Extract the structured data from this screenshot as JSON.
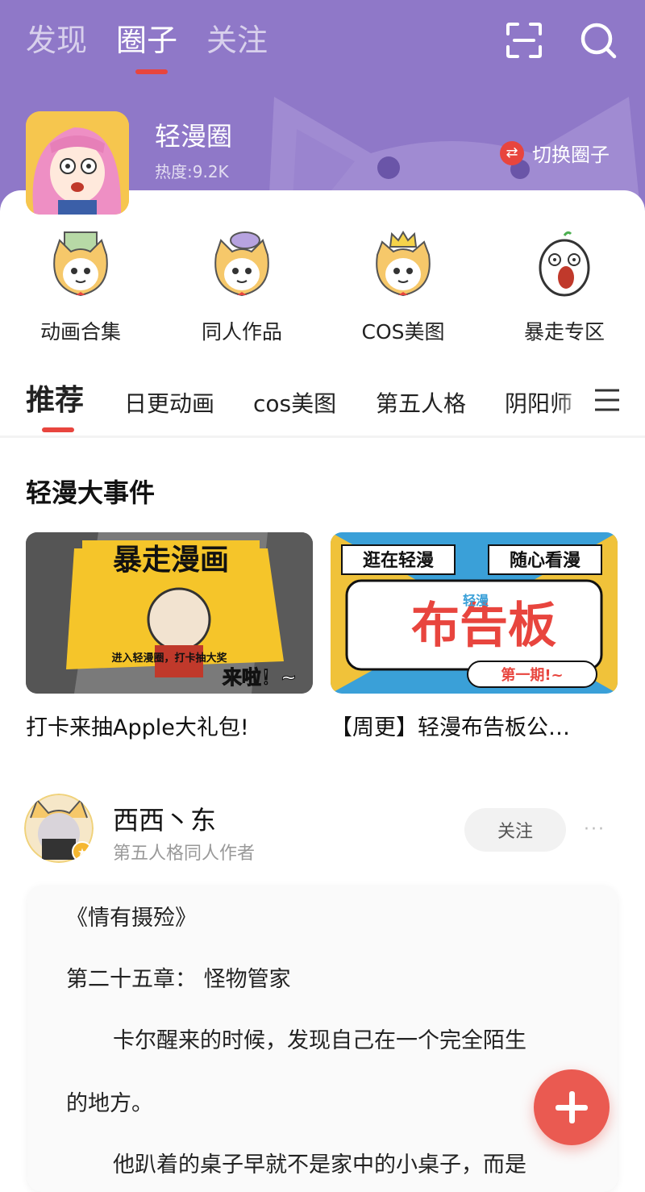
{
  "colors": {
    "header_bg": "#8f78c8",
    "accent": "#e8453e",
    "fab": "#ea5a51"
  },
  "top_tabs": [
    "发现",
    "圈子",
    "关注"
  ],
  "header": {
    "circle_name": "轻漫圈",
    "heat": "热度:9.2K",
    "switch_label": "切换圈子",
    "scan_icon": "scan-icon",
    "search_icon": "search-icon"
  },
  "quick_entries": [
    "动画合集",
    "同人作品",
    "COS美图",
    "暴走专区"
  ],
  "category_tabs": [
    "推荐",
    "日更动画",
    "cos美图",
    "第五人格",
    "阴阳师"
  ],
  "section": {
    "title": "轻漫大事件"
  },
  "banners": [
    {
      "caption": "打卡来抽Apple大礼包!",
      "art_title": "暴走漫画",
      "art_sub": "进入轻漫圈，打卡抽大奖",
      "art_tag": "来啦！~"
    },
    {
      "caption": "【周更】轻漫布告板公…",
      "art_top_left": "逛在轻漫",
      "art_top_right": "随心看漫",
      "art_title": "布告板",
      "art_mid": "轻漫",
      "art_issue": "第一期!~"
    }
  ],
  "post": {
    "author_name": "西西丶东",
    "author_desc": "第五人格同人作者",
    "follow_label": "关注",
    "more": "···",
    "lines": [
      "《情有摄殓》",
      "第二十五章： 怪物管家",
      "卡尔醒来的时候，发现自己在一个完全陌生",
      "的地方。",
      "他趴着的桌子早就不是家中的小桌子，而是"
    ]
  }
}
